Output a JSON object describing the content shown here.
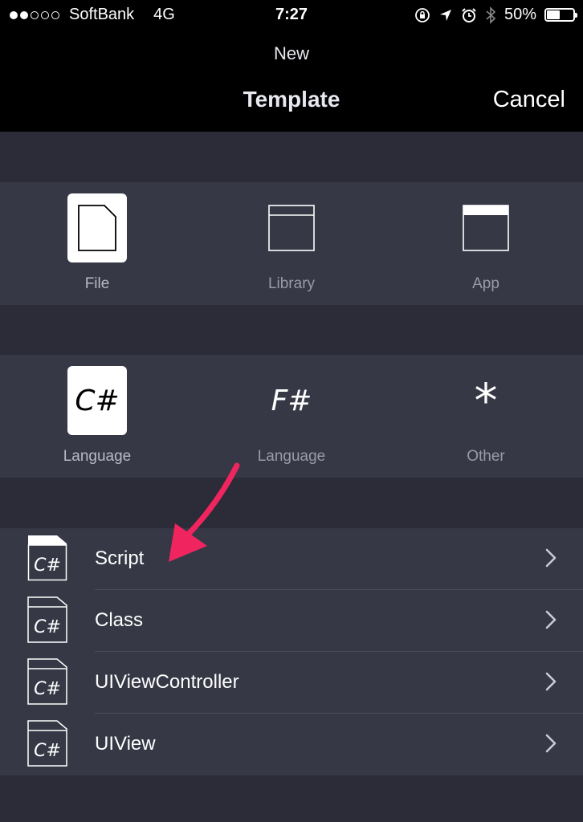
{
  "status_bar": {
    "carrier": "SoftBank",
    "network": "4G",
    "time": "7:27",
    "battery_percent": "50%",
    "battery_level": 0.5,
    "signal_bars": 2,
    "icons": [
      "orientation-lock-icon",
      "location-icon",
      "alarm-icon",
      "bluetooth-icon",
      "battery-icon"
    ]
  },
  "nav": {
    "subtitle": "New",
    "title": "Template",
    "cancel_label": "Cancel"
  },
  "project_types": [
    {
      "label": "File",
      "icon": "file-icon",
      "selected": true
    },
    {
      "label": "Library",
      "icon": "library-icon",
      "selected": false
    },
    {
      "label": "App",
      "icon": "app-icon",
      "selected": false
    }
  ],
  "languages": [
    {
      "label": "Language",
      "glyph": "C#",
      "selected": true
    },
    {
      "label": "Language",
      "glyph": "F#",
      "selected": false
    },
    {
      "label": "Other",
      "glyph": "*",
      "selected": false
    }
  ],
  "templates": [
    {
      "label": "Script",
      "glyph": "C#",
      "highlighted": true
    },
    {
      "label": "Class",
      "glyph": "C#",
      "highlighted": false
    },
    {
      "label": "UIViewController",
      "glyph": "C#",
      "highlighted": false
    },
    {
      "label": "UIView",
      "glyph": "C#",
      "highlighted": false
    }
  ],
  "colors": {
    "background": "#2b2c37",
    "section": "#363845",
    "bar": "#000000",
    "annotation_arrow": "#f0255f",
    "muted_label": "#9a9ba8"
  }
}
